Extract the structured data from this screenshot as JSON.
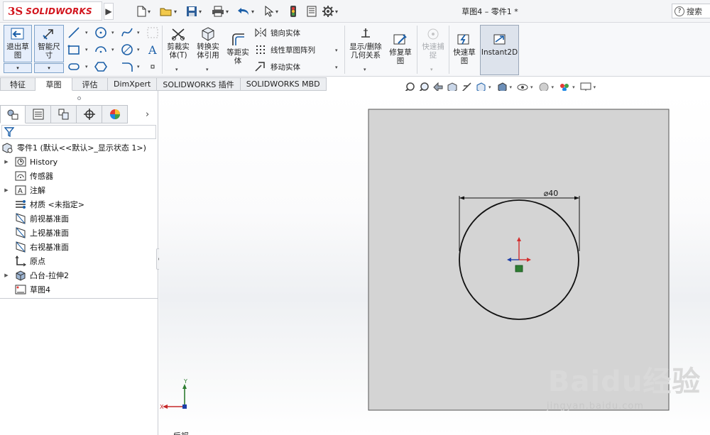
{
  "app": {
    "logo_prefix": "3S",
    "logo_text": "SOLIDWORKS",
    "document_title": "草图4 – 零件1 *",
    "search_label": "搜索"
  },
  "ribbon": {
    "exit_sketch": "退出草图",
    "smart_dimension": "智能尺寸",
    "trim_entities": "剪裁实体(T)",
    "convert_entities": "转换实体引用",
    "offset_entities": "等距实体",
    "mirror_entities": "镜向实体",
    "linear_pattern": "线性草图阵列",
    "move_entities": "移动实体",
    "display_relations": "显示/删除几何关系",
    "repair_sketch": "修复草图",
    "quick_snaps": "快速捕捉",
    "rapid_sketch": "快速草图",
    "instant2d": "Instant2D"
  },
  "tabs": [
    {
      "label": "特征",
      "active": false
    },
    {
      "label": "草图",
      "active": true
    },
    {
      "label": "评估",
      "active": false
    },
    {
      "label": "DimXpert",
      "active": false
    },
    {
      "label": "SOLIDWORKS 插件",
      "active": false
    },
    {
      "label": "SOLIDWORKS MBD",
      "active": false
    }
  ],
  "tree": {
    "root": "零件1 (默认<<默认>_显示状态 1>)",
    "items": [
      {
        "label": "History",
        "icon": "history-icon",
        "expandable": true
      },
      {
        "label": "传感器",
        "icon": "sensor-icon",
        "expandable": false
      },
      {
        "label": "注解",
        "icon": "annotation-icon",
        "expandable": true
      },
      {
        "label": "材质 <未指定>",
        "icon": "material-icon",
        "expandable": false
      },
      {
        "label": "前视基准面",
        "icon": "plane-icon",
        "expandable": false
      },
      {
        "label": "上视基准面",
        "icon": "plane-icon",
        "expandable": false
      },
      {
        "label": "右视基准面",
        "icon": "plane-icon",
        "expandable": false
      },
      {
        "label": "原点",
        "icon": "origin-icon",
        "expandable": false
      },
      {
        "label": "凸台-拉伸2",
        "icon": "extrude-icon",
        "expandable": true
      },
      {
        "label": "草图4",
        "icon": "sketch-icon",
        "expandable": false
      }
    ]
  },
  "sketch": {
    "dimension_label": "⌀40",
    "axis_x": "X",
    "axis_y": "Y",
    "view_label": "后视"
  },
  "watermark": {
    "main": "Baidu经验",
    "sub": "jingyan.baidu.com"
  },
  "colors": {
    "accent": "#1b5fa8",
    "logo_red": "#d2141d",
    "sketch_plane": "#d4d4d4"
  }
}
